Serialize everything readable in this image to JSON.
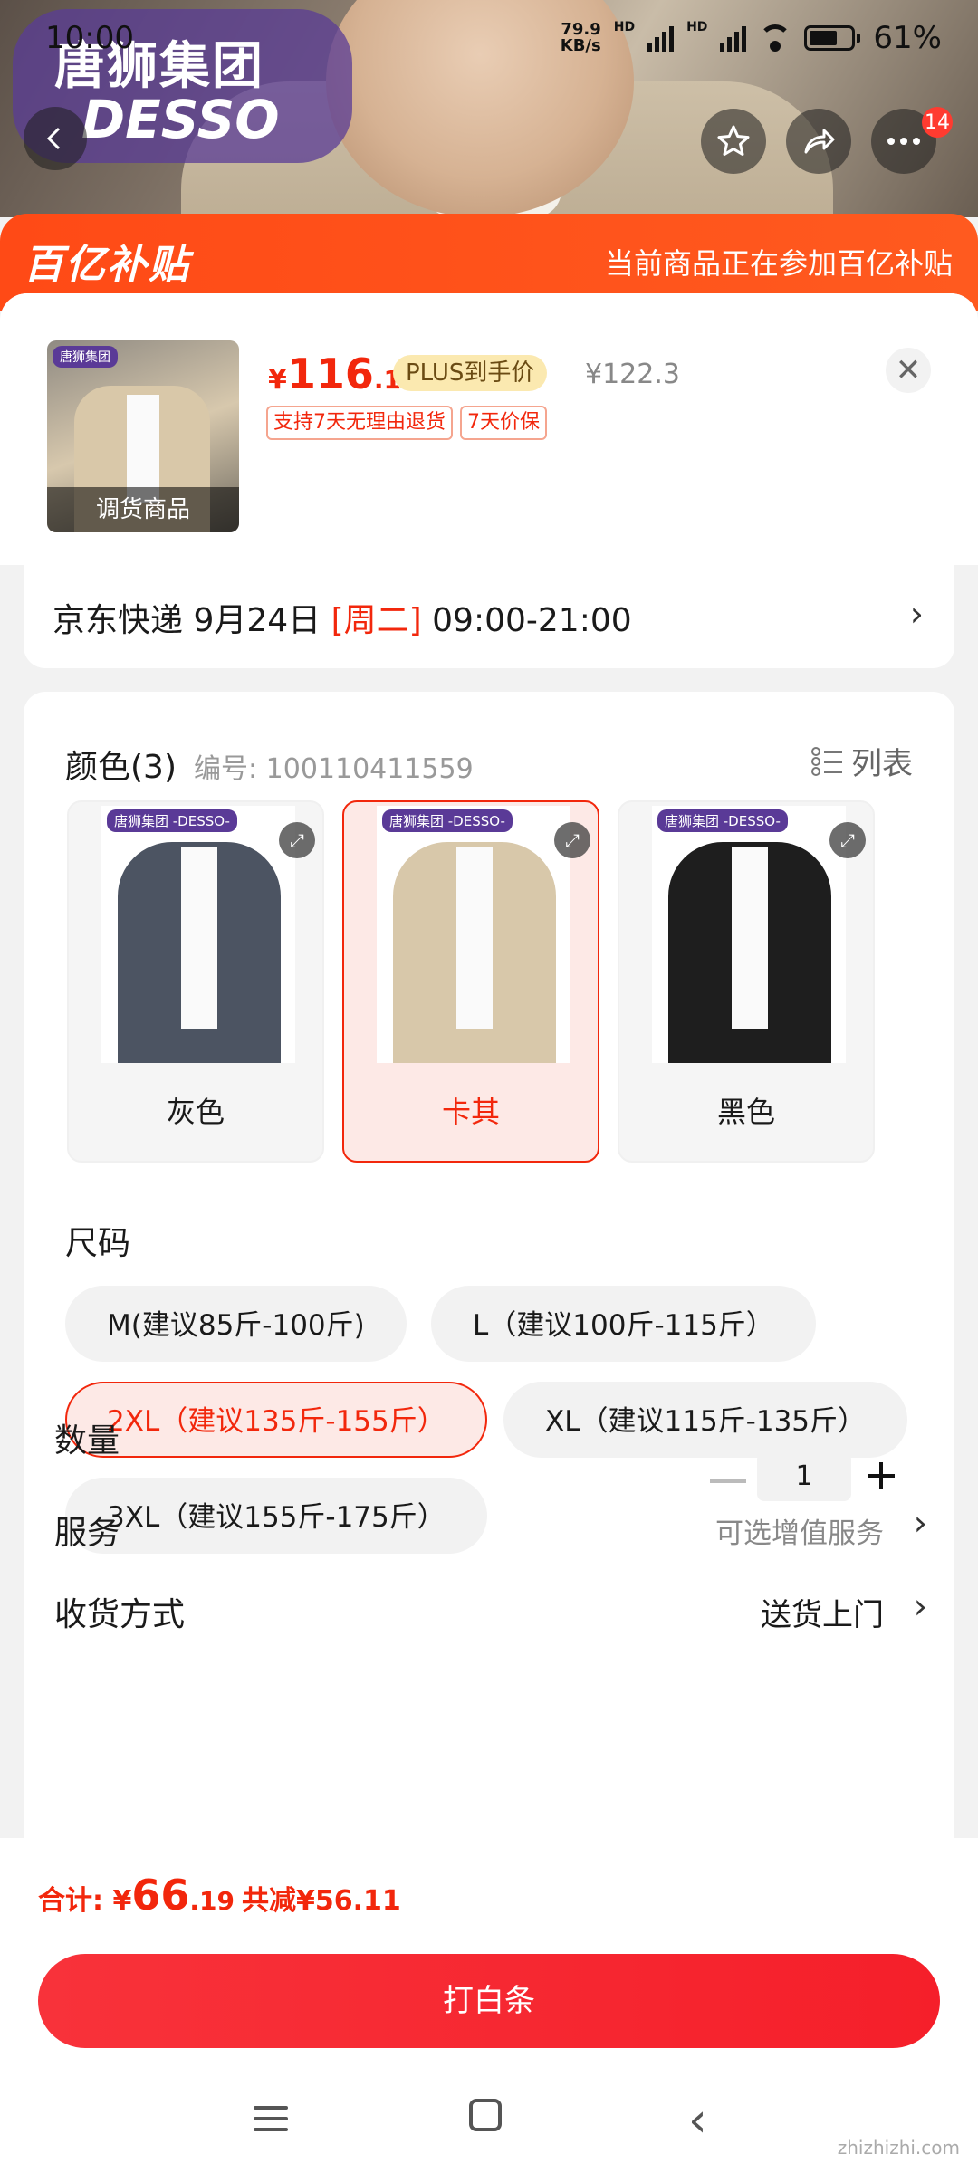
{
  "status_bar": {
    "time": "10:00",
    "net_speed_value": "79.9",
    "net_speed_unit": "KB/s",
    "sim1": "HD",
    "sim2": "HD",
    "battery": "61%"
  },
  "hero": {
    "brand_cn": "唐狮集团",
    "brand_en": "DESSO",
    "cart_badge": "14"
  },
  "banner": {
    "logo": "百亿补贴",
    "note": "当前商品正在参加百亿补贴"
  },
  "product": {
    "thumb_caption": "调货商品",
    "price_currency": "¥",
    "price_int": "116",
    "price_dec": ".19",
    "plus_label": "PLUS到手价",
    "original_price": "¥122.3",
    "tags": [
      "支持7天无理由退货",
      "7天价保"
    ]
  },
  "delivery": {
    "prefix": "京东快递 9月24日 ",
    "weekday": "[周二]",
    "window": " 09:00-21:00"
  },
  "color_section": {
    "title": "颜色(3)",
    "code_label": "编号: 100110411559",
    "list_toggle": "列表",
    "brand_tag": "唐狮集团 -DESSO-",
    "options": [
      {
        "name": "灰色",
        "color": "#4c5462",
        "selected": false
      },
      {
        "name": "卡其",
        "color": "#d8c8aa",
        "selected": true
      },
      {
        "name": "黑色",
        "color": "#1e1e1e",
        "selected": false
      }
    ]
  },
  "size_section": {
    "title": "尺码",
    "options": [
      {
        "label": "M(建议85斤-100斤)",
        "selected": false
      },
      {
        "label": "L（建议100斤-115斤）",
        "selected": false
      },
      {
        "label": "2XL（建议135斤-155斤）",
        "selected": true
      },
      {
        "label": "XL（建议115斤-135斤）",
        "selected": false
      },
      {
        "label": "3XL（建议155斤-175斤）",
        "selected": false
      }
    ]
  },
  "quantity": {
    "label": "数量",
    "value": "1"
  },
  "service": {
    "label": "服务",
    "value": "可选增值服务"
  },
  "shipping": {
    "label": "收货方式",
    "value": "送货上门"
  },
  "footer": {
    "total_label": "合计: ¥",
    "total_int": "66",
    "total_dec": ".19",
    "discount": "共减¥56.11",
    "pay_button": "打白条"
  },
  "watermark": "zhizhizhi.com",
  "colors": {
    "accent": "#f2270c",
    "banner": "#ff4a16"
  }
}
